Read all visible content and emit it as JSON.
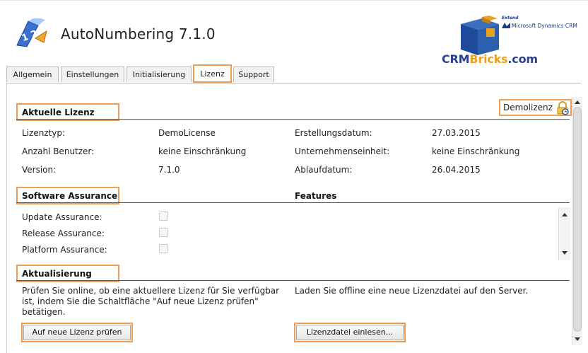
{
  "app": {
    "title": "AutoNumbering 7.1.0",
    "brand": {
      "extend": "Extend",
      "ms": "Microsoft Dynamics CRM",
      "name_part1": "CRM",
      "name_part2": "Bricks",
      "name_part3": ".com"
    }
  },
  "tabs": [
    {
      "label": "Allgemein",
      "active": false
    },
    {
      "label": "Einstellungen",
      "active": false
    },
    {
      "label": "Initialisierung",
      "active": false
    },
    {
      "label": "Lizenz",
      "active": true
    },
    {
      "label": "Support",
      "active": false
    }
  ],
  "license": {
    "section_title": "Aktuelle Lizenz",
    "badge": "Demolizenz",
    "fields_left": [
      {
        "label": "Lizenztyp:",
        "value": "DemoLicense"
      },
      {
        "label": "Anzahl Benutzer:",
        "value": "keine Einschränkung"
      },
      {
        "label": "Version:",
        "value": "7.1.0"
      }
    ],
    "fields_right": [
      {
        "label": "Erstellungsdatum:",
        "value": "27.03.2015"
      },
      {
        "label": "Unternehmenseinheit:",
        "value": "keine Einschränkung"
      },
      {
        "label": "Ablaufdatum:",
        "value": "26.04.2015"
      }
    ]
  },
  "assurance": {
    "section_title": "Software Assurance",
    "features_title": "Features",
    "items": [
      {
        "label": "Update Assurance:",
        "checked": false
      },
      {
        "label": "Release Assurance:",
        "checked": false
      },
      {
        "label": "Platform Assurance:",
        "checked": false
      }
    ]
  },
  "update": {
    "section_title": "Aktualisierung",
    "online_text_line1": "Prüfen Sie online, ob eine aktuellere Lizenz für Sie verfügbar",
    "online_text_line2": "ist, indem Sie die Schaltfläche \"Auf neue Lizenz prüfen\"",
    "online_text_line3": "betätigen.",
    "offline_text": "Laden Sie offline eine neue Lizenzdatei auf den Server.",
    "check_button": "Auf neue Lizenz prüfen",
    "upload_button": "Lizenzdatei einlesen..."
  },
  "colors": {
    "highlight": "#f29b54",
    "brand_blue": "#2a3f8f",
    "brand_orange": "#e8a21c"
  }
}
